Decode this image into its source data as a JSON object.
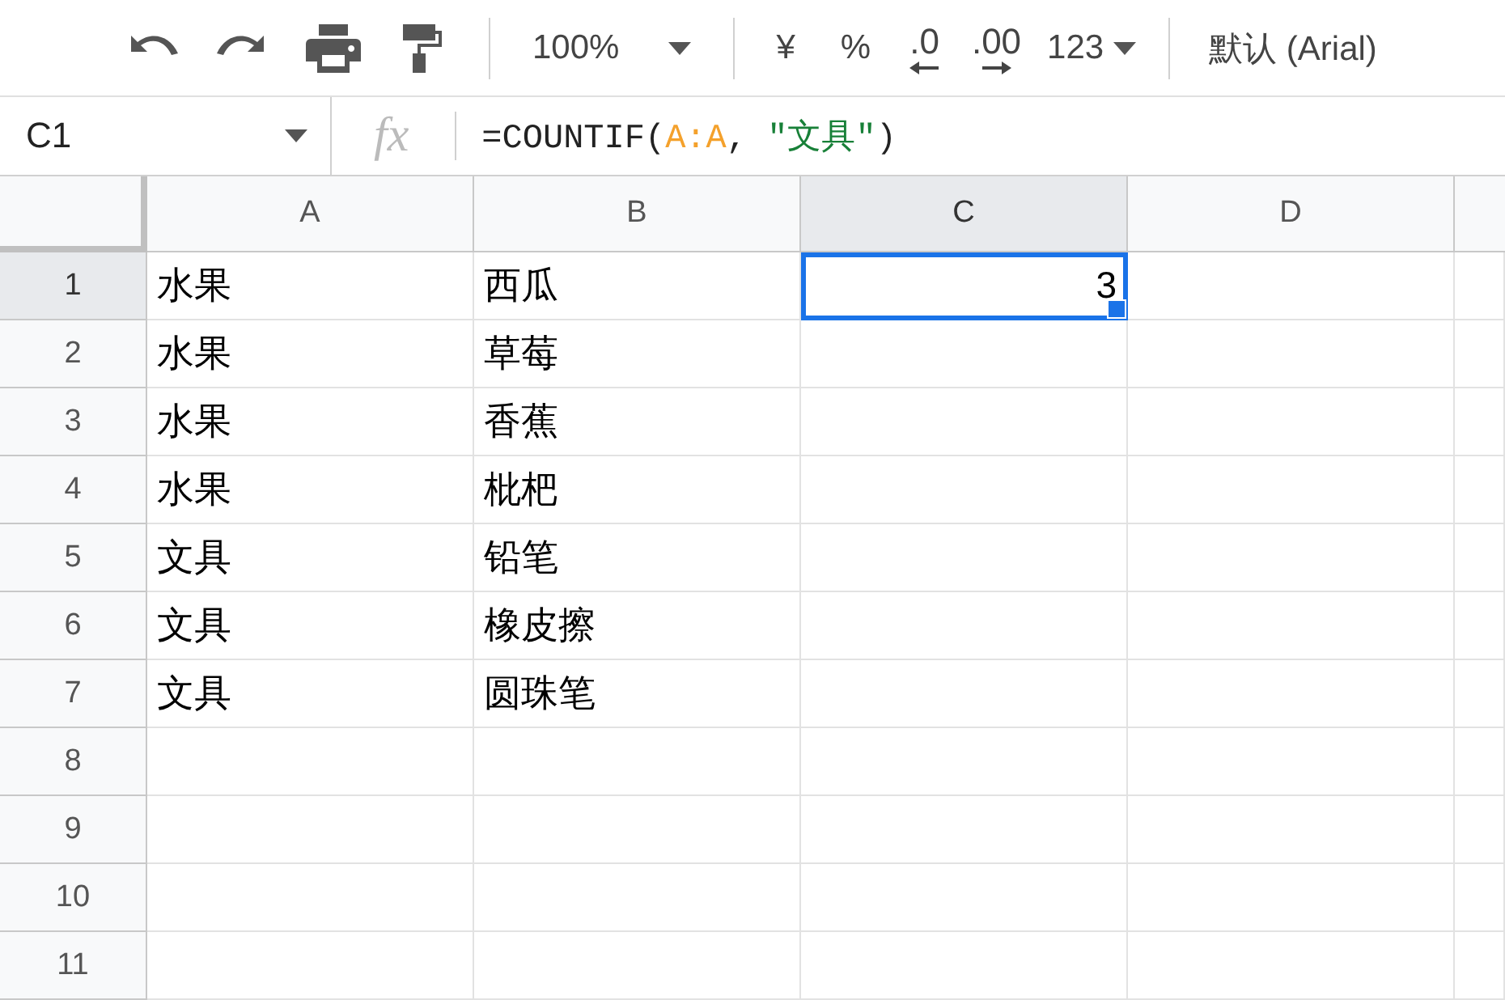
{
  "toolbar": {
    "zoom": "100%",
    "currency": "¥",
    "percent": "%",
    "decrease_decimal": ".0",
    "increase_decimal": ".00",
    "number_format": "123",
    "font": "默认 (Arial)"
  },
  "formula_bar": {
    "cell_ref": "C1",
    "fx": "fx",
    "formula": [
      {
        "kind": "plain",
        "text": "=COUNTIF("
      },
      {
        "kind": "range",
        "text": "A:A"
      },
      {
        "kind": "plain",
        "text": ", "
      },
      {
        "kind": "string",
        "text": "\"文具\""
      },
      {
        "kind": "plain",
        "text": ")"
      }
    ]
  },
  "columns": [
    {
      "label": "A",
      "selected": false
    },
    {
      "label": "B",
      "selected": false
    },
    {
      "label": "C",
      "selected": true
    },
    {
      "label": "D",
      "selected": false
    }
  ],
  "rows": [
    {
      "number": "1",
      "selected": true,
      "cells": [
        {
          "text": "水果",
          "kind": "text",
          "selected": false
        },
        {
          "text": "西瓜",
          "kind": "text",
          "selected": false
        },
        {
          "text": "3",
          "kind": "number",
          "selected": true
        }
      ]
    },
    {
      "number": "2",
      "selected": false,
      "cells": [
        {
          "text": "水果",
          "kind": "text",
          "selected": false
        },
        {
          "text": "草莓",
          "kind": "text",
          "selected": false
        }
      ]
    },
    {
      "number": "3",
      "selected": false,
      "cells": [
        {
          "text": "水果",
          "kind": "text",
          "selected": false
        },
        {
          "text": "香蕉",
          "kind": "text",
          "selected": false
        }
      ]
    },
    {
      "number": "4",
      "selected": false,
      "cells": [
        {
          "text": "水果",
          "kind": "text",
          "selected": false
        },
        {
          "text": "枇杷",
          "kind": "text",
          "selected": false
        }
      ]
    },
    {
      "number": "5",
      "selected": false,
      "cells": [
        {
          "text": "文具",
          "kind": "text",
          "selected": false
        },
        {
          "text": "铅笔",
          "kind": "text",
          "selected": false
        }
      ]
    },
    {
      "number": "6",
      "selected": false,
      "cells": [
        {
          "text": "文具",
          "kind": "text",
          "selected": false
        },
        {
          "text": "橡皮擦",
          "kind": "text",
          "selected": false
        }
      ]
    },
    {
      "number": "7",
      "selected": false,
      "cells": [
        {
          "text": "文具",
          "kind": "text",
          "selected": false
        },
        {
          "text": "圆珠笔",
          "kind": "text",
          "selected": false
        }
      ]
    },
    {
      "number": "8",
      "selected": false
    },
    {
      "number": "9",
      "selected": false
    },
    {
      "number": "10",
      "selected": false
    },
    {
      "number": "11",
      "selected": false
    }
  ]
}
